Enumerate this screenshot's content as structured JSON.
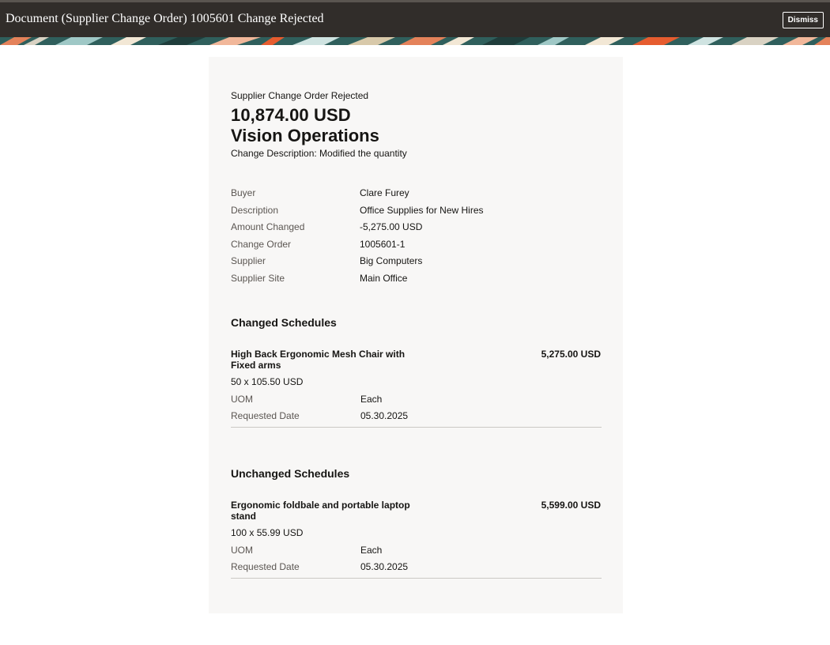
{
  "header": {
    "title": "Document (Supplier Change Order) 1005601 Change Rejected",
    "dismiss_label": "Dismiss"
  },
  "summary": {
    "eyebrow": "Supplier Change Order Rejected",
    "amount": "10,874.00 USD",
    "organization": "Vision Operations",
    "change_description": "Change Description: Modified the quantity"
  },
  "details": [
    {
      "label": "Buyer",
      "value": "Clare Furey"
    },
    {
      "label": "Description",
      "value": "Office Supplies for New Hires"
    },
    {
      "label": "Amount Changed",
      "value": "-5,275.00 USD"
    },
    {
      "label": "Change Order",
      "value": "1005601-1"
    },
    {
      "label": "Supplier",
      "value": "Big Computers"
    },
    {
      "label": "Supplier Site",
      "value": "Main Office"
    }
  ],
  "changed_schedules": {
    "heading": "Changed Schedules",
    "items": [
      {
        "name": "High Back Ergonomic Mesh Chair with Fixed arms",
        "total": "5,275.00 USD",
        "quantity_price": "50 x 105.50 USD",
        "uom_label": "UOM",
        "uom": "Each",
        "requested_date_label": "Requested Date",
        "requested_date": "05.30.2025"
      }
    ]
  },
  "unchanged_schedules": {
    "heading": "Unchanged Schedules",
    "items": [
      {
        "name": "Ergonomic foldbale and portable laptop stand",
        "total": "5,599.00 USD",
        "quantity_price": "100 x 55.99 USD",
        "uom_label": "UOM",
        "uom": "Each",
        "requested_date_label": "Requested Date",
        "requested_date": "05.30.2025"
      }
    ]
  },
  "colors": {
    "header_bg": "#312d2a",
    "card_bg": "#f8f7f6",
    "label_text": "#5b5652",
    "divider": "#cbc8c5"
  }
}
